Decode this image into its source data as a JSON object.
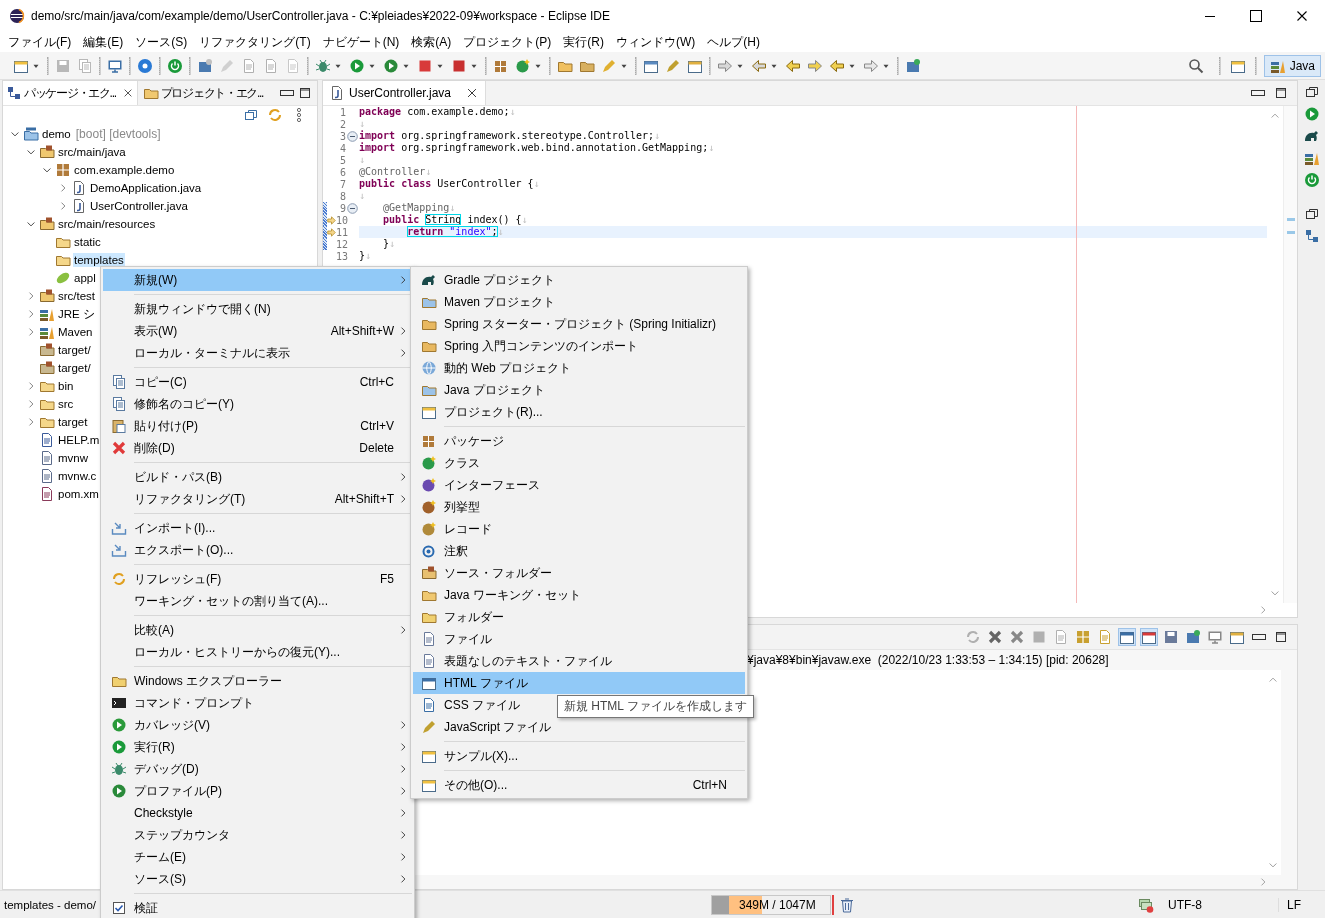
{
  "window": {
    "title": "demo/src/main/java/com/example/demo/UserController.java - C:¥pleiades¥2022-09¥workspace - Eclipse IDE"
  },
  "menu_bar": [
    "ファイル(F)",
    "編集(E)",
    "ソース(S)",
    "リファクタリング(T)",
    "ナビゲート(N)",
    "検索(A)",
    "プロジェクト(P)",
    "実行(R)",
    "ウィンドウ(W)",
    "ヘルプ(H)"
  ],
  "perspective": {
    "label": "Java",
    "selected": true
  },
  "explorer": {
    "tabs": [
      {
        "label": "パッケージ・エク...",
        "selected": true
      },
      {
        "label": "プロジェクト・エク...",
        "selected": false
      }
    ],
    "tree": [
      {
        "kind": "project",
        "label": "demo",
        "decoration": "[boot] [devtools]",
        "selected": false,
        "expanded": true,
        "children": [
          {
            "kind": "source_folder",
            "label": "src/main/java",
            "selected": false,
            "expanded": true,
            "children": [
              {
                "kind": "package",
                "label": "com.example.demo",
                "selected": false,
                "expanded": true,
                "children": [
                  {
                    "kind": "java_file",
                    "label": "DemoApplication.java",
                    "selected": false,
                    "expanded": false
                  },
                  {
                    "kind": "java_file",
                    "label": "UserController.java",
                    "selected": false,
                    "expanded": false
                  }
                ]
              }
            ]
          },
          {
            "kind": "source_folder",
            "label": "src/main/resources",
            "selected": false,
            "expanded": true,
            "children": [
              {
                "kind": "folder",
                "label": "static",
                "selected": false
              },
              {
                "kind": "folder",
                "label": "templates",
                "selected": true
              },
              {
                "kind": "config_file",
                "label": "appl",
                "selected": false
              }
            ]
          },
          {
            "kind": "source_folder",
            "label": "src/test",
            "selected": false,
            "expanded": false
          },
          {
            "kind": "library",
            "label": "JRE シ",
            "selected": false,
            "expanded": false
          },
          {
            "kind": "library",
            "label": "Maven",
            "selected": false,
            "expanded": false
          },
          {
            "kind": "output_folder",
            "label": "target/",
            "selected": false
          },
          {
            "kind": "output_folder",
            "label": "target/",
            "selected": false
          },
          {
            "kind": "folder",
            "label": "bin",
            "selected": false,
            "expanded": false
          },
          {
            "kind": "folder",
            "label": "src",
            "selected": false,
            "expanded": false
          },
          {
            "kind": "folder",
            "label": "target",
            "selected": false,
            "expanded": false
          },
          {
            "kind": "doc_file",
            "label": "HELP.m",
            "selected": false
          },
          {
            "kind": "text_file",
            "label": "mvnw",
            "selected": false
          },
          {
            "kind": "text_file",
            "label": "mvnw.c",
            "selected": false
          },
          {
            "kind": "xml_file",
            "label": "pom.xm",
            "selected": false
          }
        ]
      }
    ]
  },
  "editor": {
    "tab": "UserController.java",
    "lines": [
      {
        "number": "1",
        "current": false,
        "fold": false,
        "range": false,
        "marker": false,
        "tokens": [
          {
            "kind": "keyword",
            "text": "package"
          },
          {
            "kind": "plain",
            "text": " com.example.demo;"
          },
          {
            "kind": "eol",
            "text": "↓"
          }
        ]
      },
      {
        "number": "2",
        "current": false,
        "fold": false,
        "range": false,
        "marker": false,
        "tokens": [
          {
            "kind": "eol",
            "text": "↓"
          }
        ]
      },
      {
        "number": "3",
        "current": false,
        "fold": true,
        "range": false,
        "marker": false,
        "tokens": [
          {
            "kind": "keyword",
            "text": "import"
          },
          {
            "kind": "plain",
            "text": " org.springframework.stereotype.Controller;"
          },
          {
            "kind": "eol",
            "text": "↓"
          }
        ]
      },
      {
        "number": "4",
        "current": false,
        "fold": false,
        "range": false,
        "marker": false,
        "tokens": [
          {
            "kind": "keyword",
            "text": "import"
          },
          {
            "kind": "plain",
            "text": " org.springframework.web.bind.annotation.GetMapping;"
          },
          {
            "kind": "eol",
            "text": "↓"
          }
        ]
      },
      {
        "number": "5",
        "current": false,
        "fold": false,
        "range": false,
        "marker": false,
        "tokens": [
          {
            "kind": "eol",
            "text": "↓"
          }
        ]
      },
      {
        "number": "6",
        "current": false,
        "fold": false,
        "range": false,
        "marker": false,
        "tokens": [
          {
            "kind": "annotation",
            "text": "@Controller"
          },
          {
            "kind": "eol",
            "text": "↓"
          }
        ]
      },
      {
        "number": "7",
        "current": false,
        "fold": false,
        "range": false,
        "marker": false,
        "tokens": [
          {
            "kind": "keyword",
            "text": "public class"
          },
          {
            "kind": "plain",
            "text": " UserController {"
          },
          {
            "kind": "eol",
            "text": "↓"
          }
        ]
      },
      {
        "number": "8",
        "current": false,
        "fold": false,
        "range": false,
        "marker": false,
        "tokens": [
          {
            "kind": "eol",
            "text": "↓"
          }
        ]
      },
      {
        "number": "9",
        "current": false,
        "fold": true,
        "range": true,
        "marker": false,
        "tokens": [
          {
            "kind": "annotation",
            "text": "    @GetMapping"
          },
          {
            "kind": "eol",
            "text": "↓"
          }
        ]
      },
      {
        "number": "10",
        "current": false,
        "fold": false,
        "range": true,
        "marker": true,
        "tokens": [
          {
            "kind": "keyword",
            "text": "    public "
          },
          {
            "kind": "box",
            "tokens": [
              {
                "kind": "plain",
                "text": "String"
              }
            ]
          },
          {
            "kind": "plain",
            "text": " index() {"
          },
          {
            "kind": "eol",
            "text": "↓"
          }
        ]
      },
      {
        "number": "11",
        "current": true,
        "fold": false,
        "range": true,
        "marker": true,
        "tokens": [
          {
            "kind": "box",
            "tokens": [
              {
                "kind": "keyword",
                "text": "        return "
              },
              {
                "kind": "string",
                "text": "\"index\""
              },
              {
                "kind": "plain",
                "text": ";"
              }
            ]
          },
          {
            "kind": "eol",
            "text": "↓"
          }
        ]
      },
      {
        "number": "12",
        "current": false,
        "fold": false,
        "range": true,
        "marker": false,
        "tokens": [
          {
            "kind": "plain",
            "text": "    }"
          },
          {
            "kind": "eol",
            "text": "↓"
          }
        ]
      },
      {
        "number": "13",
        "current": false,
        "fold": false,
        "range": false,
        "marker": false,
        "tokens": [
          {
            "kind": "plain",
            "text": "}"
          },
          {
            "kind": "eol",
            "text": "↓"
          }
        ]
      }
    ]
  },
  "console": {
    "header": "¥java¥8¥bin¥javaw.exe  (2022/10/23 1:33:53 – 1:34:15) [pid: 20628]"
  },
  "context_menu": {
    "items": [
      {
        "kind": "item",
        "label": "新規(W)",
        "submenu": true,
        "selected": true
      },
      {
        "kind": "separator"
      },
      {
        "kind": "item",
        "label": "新規ウィンドウで開く(N)",
        "submenu": false,
        "selected": false
      },
      {
        "kind": "item",
        "label": "表示(W)",
        "shortcut": "Alt+Shift+W",
        "submenu": true,
        "selected": false
      },
      {
        "kind": "item",
        "label": "ローカル・ターミナルに表示",
        "submenu": true,
        "selected": false
      },
      {
        "kind": "separator"
      },
      {
        "kind": "item",
        "label": "コピー(C)",
        "shortcut": "Ctrl+C",
        "submenu": false,
        "selected": false
      },
      {
        "kind": "item",
        "label": "修飾名のコピー(Y)",
        "submenu": false,
        "selected": false
      },
      {
        "kind": "item",
        "label": "貼り付け(P)",
        "shortcut": "Ctrl+V",
        "submenu": false,
        "selected": false
      },
      {
        "kind": "item",
        "label": "削除(D)",
        "shortcut": "Delete",
        "submenu": false,
        "selected": false
      },
      {
        "kind": "separator"
      },
      {
        "kind": "item",
        "label": "ビルド・パス(B)",
        "submenu": true,
        "selected": false
      },
      {
        "kind": "item",
        "label": "リファクタリング(T)",
        "shortcut": "Alt+Shift+T",
        "submenu": true,
        "selected": false
      },
      {
        "kind": "separator"
      },
      {
        "kind": "item",
        "label": "インポート(I)...",
        "submenu": false,
        "selected": false
      },
      {
        "kind": "item",
        "label": "エクスポート(O)...",
        "submenu": false,
        "selected": false
      },
      {
        "kind": "separator"
      },
      {
        "kind": "item",
        "label": "リフレッシュ(F)",
        "shortcut": "F5",
        "submenu": false,
        "selected": false
      },
      {
        "kind": "item",
        "label": "ワーキング・セットの割り当て(A)...",
        "submenu": false,
        "selected": false
      },
      {
        "kind": "separator"
      },
      {
        "kind": "item",
        "label": "比較(A)",
        "submenu": true,
        "selected": false
      },
      {
        "kind": "item",
        "label": "ローカル・ヒストリーからの復元(Y)...",
        "submenu": false,
        "selected": false
      },
      {
        "kind": "separator"
      },
      {
        "kind": "item",
        "label": "Windows エクスプローラー",
        "submenu": false,
        "selected": false
      },
      {
        "kind": "item",
        "label": "コマンド・プロンプト",
        "submenu": false,
        "selected": false
      },
      {
        "kind": "item",
        "label": "カバレッジ(V)",
        "submenu": true,
        "selected": false
      },
      {
        "kind": "item",
        "label": "実行(R)",
        "submenu": true,
        "selected": false
      },
      {
        "kind": "item",
        "label": "デバッグ(D)",
        "submenu": true,
        "selected": false
      },
      {
        "kind": "item",
        "label": "プロファイル(P)",
        "submenu": true,
        "selected": false
      },
      {
        "kind": "item",
        "label": "Checkstyle",
        "submenu": true,
        "selected": false
      },
      {
        "kind": "item",
        "label": "ステップカウンタ",
        "submenu": true,
        "selected": false
      },
      {
        "kind": "item",
        "label": "チーム(E)",
        "submenu": true,
        "selected": false
      },
      {
        "kind": "item",
        "label": "ソース(S)",
        "submenu": true,
        "selected": false
      },
      {
        "kind": "separator"
      },
      {
        "kind": "item",
        "label": "検証",
        "submenu": false,
        "selected": false
      }
    ]
  },
  "new_submenu": {
    "items": [
      {
        "kind": "item",
        "label": "Gradle プロジェクト",
        "selected": false
      },
      {
        "kind": "item",
        "label": "Maven プロジェクト",
        "selected": false
      },
      {
        "kind": "item",
        "label": "Spring スターター・プロジェクト (Spring Initializr)",
        "selected": false
      },
      {
        "kind": "item",
        "label": "Spring 入門コンテンツのインポート",
        "selected": false
      },
      {
        "kind": "item",
        "label": "動的 Web プロジェクト",
        "selected": false
      },
      {
        "kind": "item",
        "label": "Java プロジェクト",
        "selected": false
      },
      {
        "kind": "item",
        "label": "プロジェクト(R)...",
        "selected": false
      },
      {
        "kind": "separator"
      },
      {
        "kind": "item",
        "label": "パッケージ",
        "selected": false
      },
      {
        "kind": "item",
        "label": "クラス",
        "selected": false
      },
      {
        "kind": "item",
        "label": "インターフェース",
        "selected": false
      },
      {
        "kind": "item",
        "label": "列挙型",
        "selected": false
      },
      {
        "kind": "item",
        "label": "レコード",
        "selected": false
      },
      {
        "kind": "item",
        "label": "注釈",
        "selected": false
      },
      {
        "kind": "item",
        "label": "ソース・フォルダー",
        "selected": false
      },
      {
        "kind": "item",
        "label": "Java ワーキング・セット",
        "selected": false
      },
      {
        "kind": "item",
        "label": "フォルダー",
        "selected": false
      },
      {
        "kind": "item",
        "label": "ファイル",
        "selected": false
      },
      {
        "kind": "item",
        "label": "表題なしのテキスト・ファイル",
        "selected": false
      },
      {
        "kind": "item",
        "label": "HTML ファイル",
        "selected": true
      },
      {
        "kind": "item",
        "label": "CSS ファイル",
        "selected": false
      },
      {
        "kind": "item",
        "label": "JavaScript ファイル",
        "selected": false
      },
      {
        "kind": "separator"
      },
      {
        "kind": "item",
        "label": "サンプル(X)...",
        "selected": false
      },
      {
        "kind": "separator"
      },
      {
        "kind": "item",
        "label": "その他(O)...",
        "shortcut": "Ctrl+N",
        "selected": false
      }
    ]
  },
  "tooltip": "新規 HTML ファイルを作成します",
  "status_bar": {
    "selection": "templates - demo/",
    "heap": {
      "text": "349M / 1047M",
      "level": 0.42
    },
    "encoding": "UTF-8",
    "line_delimiter": "LF"
  }
}
